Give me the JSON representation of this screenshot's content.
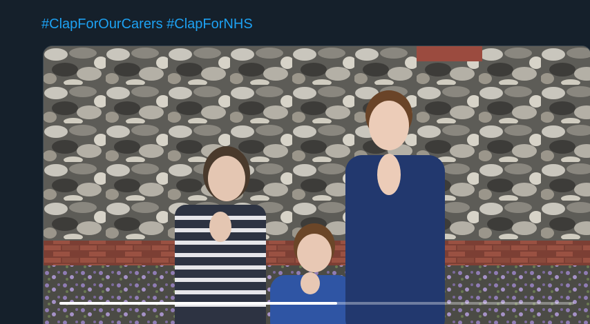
{
  "tweet": {
    "hashtags": [
      "#ClapForOurCarers",
      "#ClapForNHS"
    ]
  },
  "video": {
    "progress": 0.54,
    "colors": {
      "progress_fill": "#ffffff",
      "hashtag": "#1da1f2",
      "background": "#15202b"
    }
  }
}
